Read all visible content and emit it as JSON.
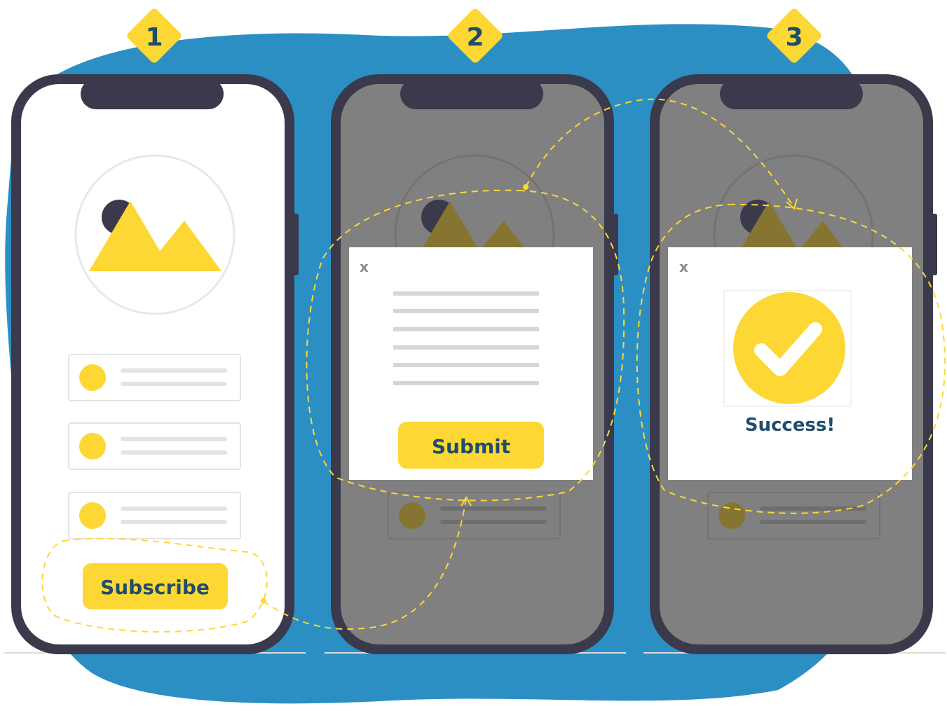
{
  "steps": [
    {
      "number": "1",
      "button_label": "Subscribe"
    },
    {
      "number": "2",
      "close_label": "x",
      "button_label": "Submit"
    },
    {
      "number": "3",
      "close_label": "x",
      "message": "Success!"
    }
  ],
  "colors": {
    "background_blob": "#2c8fc4",
    "phone_frame": "#3a3a4c",
    "accent_yellow": "#fdd835",
    "text_navy": "#1f4e6b",
    "overlay_gray": "#7f7f7f",
    "placeholder_line": "#e3e3e3"
  },
  "icons": {
    "image_placeholder": "mountain-image-icon",
    "success": "checkmark-circle-icon"
  }
}
